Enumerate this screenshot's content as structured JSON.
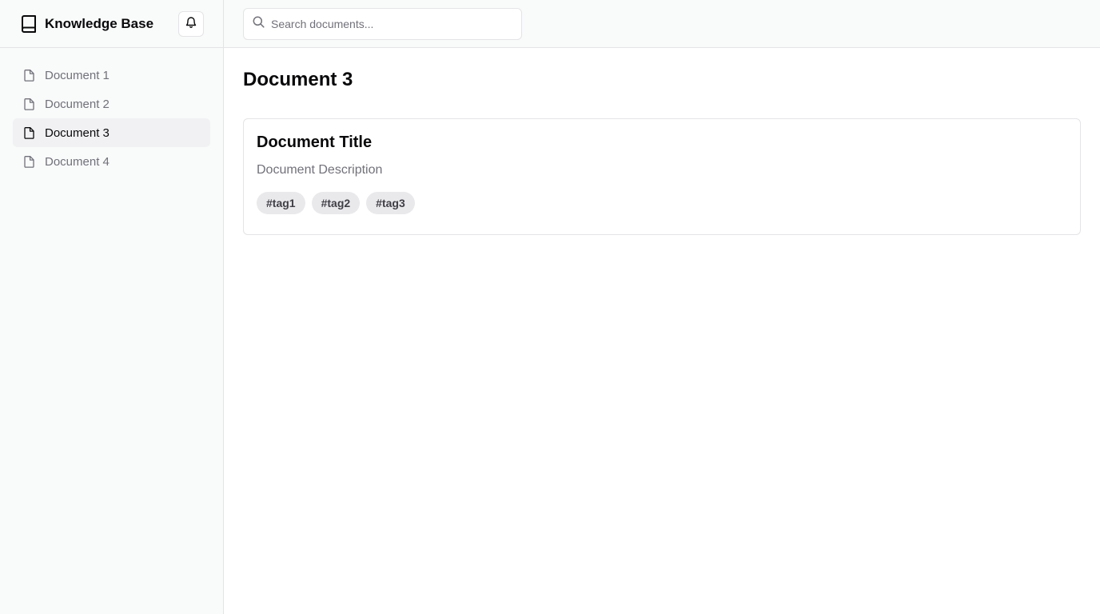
{
  "sidebar": {
    "brand_title": "Knowledge Base",
    "items": [
      {
        "label": "Document 1",
        "active": false
      },
      {
        "label": "Document 2",
        "active": false
      },
      {
        "label": "Document 3",
        "active": true
      },
      {
        "label": "Document 4",
        "active": false
      }
    ]
  },
  "search": {
    "placeholder": "Search documents...",
    "value": ""
  },
  "main": {
    "page_title": "Document 3",
    "card": {
      "title": "Document Title",
      "description": "Document Description",
      "tags": [
        "#tag1",
        "#tag2",
        "#tag3"
      ]
    }
  },
  "icons": {
    "brand": "book-icon",
    "notifications": "bell-icon",
    "document": "file-icon",
    "search": "search-icon"
  },
  "colors": {
    "sidebar_bg": "#f9fafa",
    "active_item_bg": "#f1f1f3",
    "muted_text": "#71717a",
    "border": "#e4e4e7",
    "tag_bg": "#e9e9ec"
  }
}
